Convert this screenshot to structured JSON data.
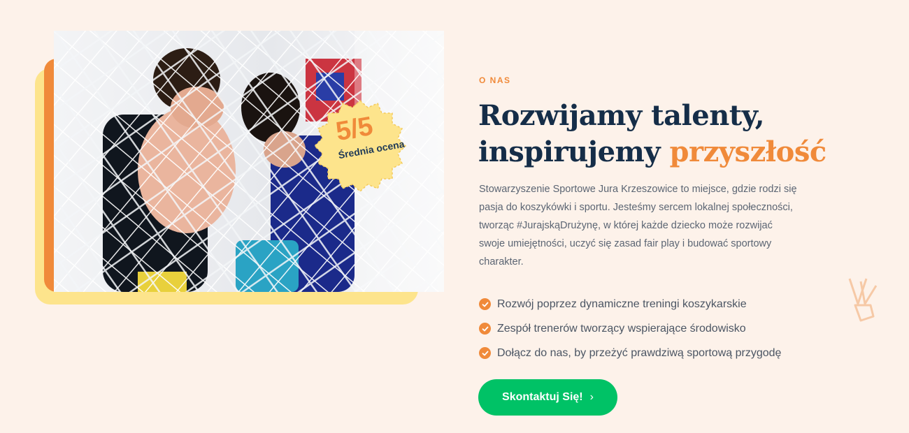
{
  "about": {
    "eyebrow": "O NAS",
    "heading_line1": "Rozwijamy talenty,",
    "heading_line2": "inspirujemy",
    "heading_accent": "przyszłość",
    "description": "Stowarzyszenie Sportowe Jura Krzeszowice to miejsce, gdzie rodzi się pasja do koszykówki i sportu. Jesteśmy sercem lokalnej społeczności, tworząc #JurajskąDrużynę, w której każde dziecko może rozwijać swoje umiejętności, uczyć się zasad fair play i budować sportowy charakter.",
    "features": [
      {
        "text": "Rozwój poprzez dynamiczne treningi koszykarskie",
        "icon": "check-circle-icon"
      },
      {
        "text": "Zespół trenerów tworzący wspierające środowisko",
        "icon": "check-circle-icon"
      },
      {
        "text": "Dołącz do nas, by przeżyć prawdziwą sportową przygodę",
        "icon": "check-circle-icon"
      }
    ],
    "cta": {
      "label": "Skontaktuj Się!",
      "icon": "chevron-right-icon"
    }
  },
  "badge": {
    "value": "5/5",
    "label": "Średnia ocena"
  },
  "colors": {
    "background": "#fdf2ea",
    "accent": "#f08a3a",
    "heading": "#152d48",
    "cta": "#00c266",
    "badge": "#fde48c"
  }
}
